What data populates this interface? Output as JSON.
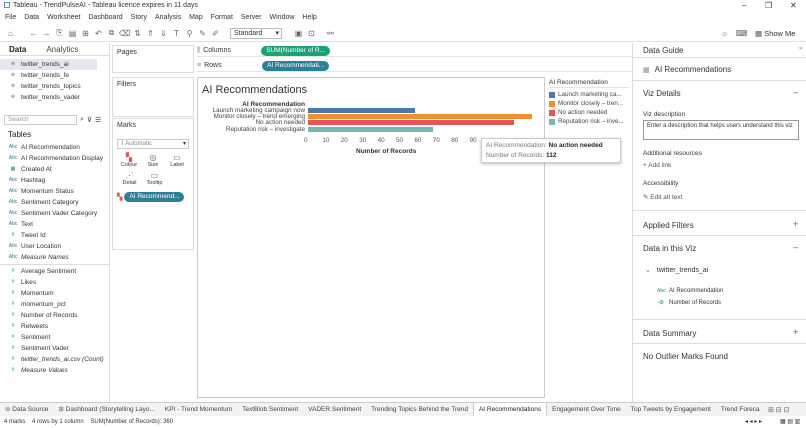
{
  "window": {
    "title": "Tableau - TrendPulseAI - Tableau licence expires in 11 days",
    "minimize": "–",
    "restore": "❐",
    "close": "✕"
  },
  "menu": [
    "File",
    "Data",
    "Worksheet",
    "Dashboard",
    "Story",
    "Analysis",
    "Map",
    "Format",
    "Server",
    "Window",
    "Help"
  ],
  "toolbar": {
    "fit_value": "Standard",
    "show_me": "Show Me"
  },
  "left_pane": {
    "tabs": {
      "data": "Data",
      "analytics": "Analytics"
    },
    "sources": [
      "twitter_trends_ai",
      "twitter_trends_fe",
      "twitter_trends_topics",
      "twitter_trends_vader"
    ],
    "search_placeholder": "Search",
    "tables_heading": "Tables",
    "dimensions": [
      {
        "icon": "Abc",
        "name": "AI Recommendation"
      },
      {
        "icon": "Abc",
        "name": "AI Recommendation Display"
      },
      {
        "icon": "▦",
        "name": "Created At"
      },
      {
        "icon": "Abc",
        "name": "Hashtag"
      },
      {
        "icon": "Abc",
        "name": "Momentum Status"
      },
      {
        "icon": "Abc",
        "name": "Sentiment Category"
      },
      {
        "icon": "Abc",
        "name": "Sentiment Vader Category"
      },
      {
        "icon": "Abc",
        "name": "Text"
      },
      {
        "icon": "#",
        "name": "Tweet Id"
      },
      {
        "icon": "Abc",
        "name": "User Location"
      },
      {
        "icon": "Abc",
        "name": "Measure Names",
        "italic": true
      }
    ],
    "measures": [
      {
        "icon": "#",
        "name": "Average Sentiment"
      },
      {
        "icon": "#",
        "name": "Likes"
      },
      {
        "icon": "#",
        "name": "Momentum"
      },
      {
        "icon": "#",
        "name": "momentum_pct"
      },
      {
        "icon": "#",
        "name": "Number of Records"
      },
      {
        "icon": "#",
        "name": "Retweets"
      },
      {
        "icon": "#",
        "name": "Sentiment"
      },
      {
        "icon": "#",
        "name": "Sentiment Vader"
      },
      {
        "icon": "#",
        "name": "twitter_trends_ai.csv (Count)",
        "italic": true
      },
      {
        "icon": "#",
        "name": "Measure Values",
        "italic": true
      }
    ]
  },
  "shelves": {
    "pages": "Pages",
    "filters": "Filters",
    "marks": "Marks",
    "mark_type": "Automatic",
    "mark_buttons": [
      "Colour",
      "Size",
      "Label",
      "Detail",
      "Tooltip"
    ],
    "colour_pill": "AI Recommend...",
    "columns_label": "Columns",
    "columns_pill": "SUM(Number of R...",
    "rows_label": "Rows",
    "rows_pill": "AI Recommendati..."
  },
  "viz": {
    "title": "AI Recommendations",
    "legend_title": "AI Recommendation",
    "legend_items": [
      "Launch marketing ca...",
      "Monitor closely – tren...",
      "No action needed",
      "Reputation risk – inve..."
    ],
    "tooltip": {
      "label1": "AI Recommendation:",
      "value1": "No action needed",
      "label2": "Number of Records:",
      "value2": "112"
    }
  },
  "chart_data": {
    "type": "bar",
    "orientation": "horizontal",
    "row_header": "AI Recommendation",
    "categories": [
      "Launch marketing campaign now",
      "Monitor closely – trend emerging",
      "No action needed",
      "Reputation risk – investigate"
    ],
    "values": [
      58,
      122,
      112,
      68
    ],
    "colors": [
      "#4e79a7",
      "#f28e2b",
      "#e15759",
      "#76b7b2"
    ],
    "xlabel": "Number of Records",
    "xticks": [
      0,
      10,
      20,
      30,
      40,
      50,
      60,
      70,
      80,
      90
    ],
    "xlim": [
      0,
      125
    ],
    "title": "AI Recommendations"
  },
  "right_pane": {
    "header": "Data Guide",
    "sheet_name": "AI Recommendations",
    "viz_details": "Viz Details",
    "viz_description": "Viz description",
    "description_placeholder": "Enter a description that helps users understand this viz",
    "additional_resources": "Additional resources",
    "add_link": "Add link",
    "accessibility": "Accessibility",
    "edit_alt": "Edit alt text",
    "applied_filters": "Applied Filters",
    "data_in_viz": "Data in this Viz",
    "source": "twitter_trends_ai",
    "fields": [
      "AI Recommendation",
      "Number of Records"
    ],
    "data_summary": "Data Summary",
    "outliers": "No Outlier Marks Found"
  },
  "sheet_tabs": [
    "Data Source",
    "Dashboard (Storytelling Layo...",
    "KPI - Trend Momentum",
    "TextBlob Sentiment",
    "VADER Sentiment",
    "Trending Topics Behind the Trend",
    "AI Recommendations",
    "Engagement Over Time",
    "Top Tweets by Engagement",
    "Trend Foreca"
  ],
  "active_tab": "AI Recommendations",
  "status": {
    "marks": "4 marks",
    "rows": "4 rows by 1 column",
    "sum": "SUM(Number of Records): 360"
  }
}
